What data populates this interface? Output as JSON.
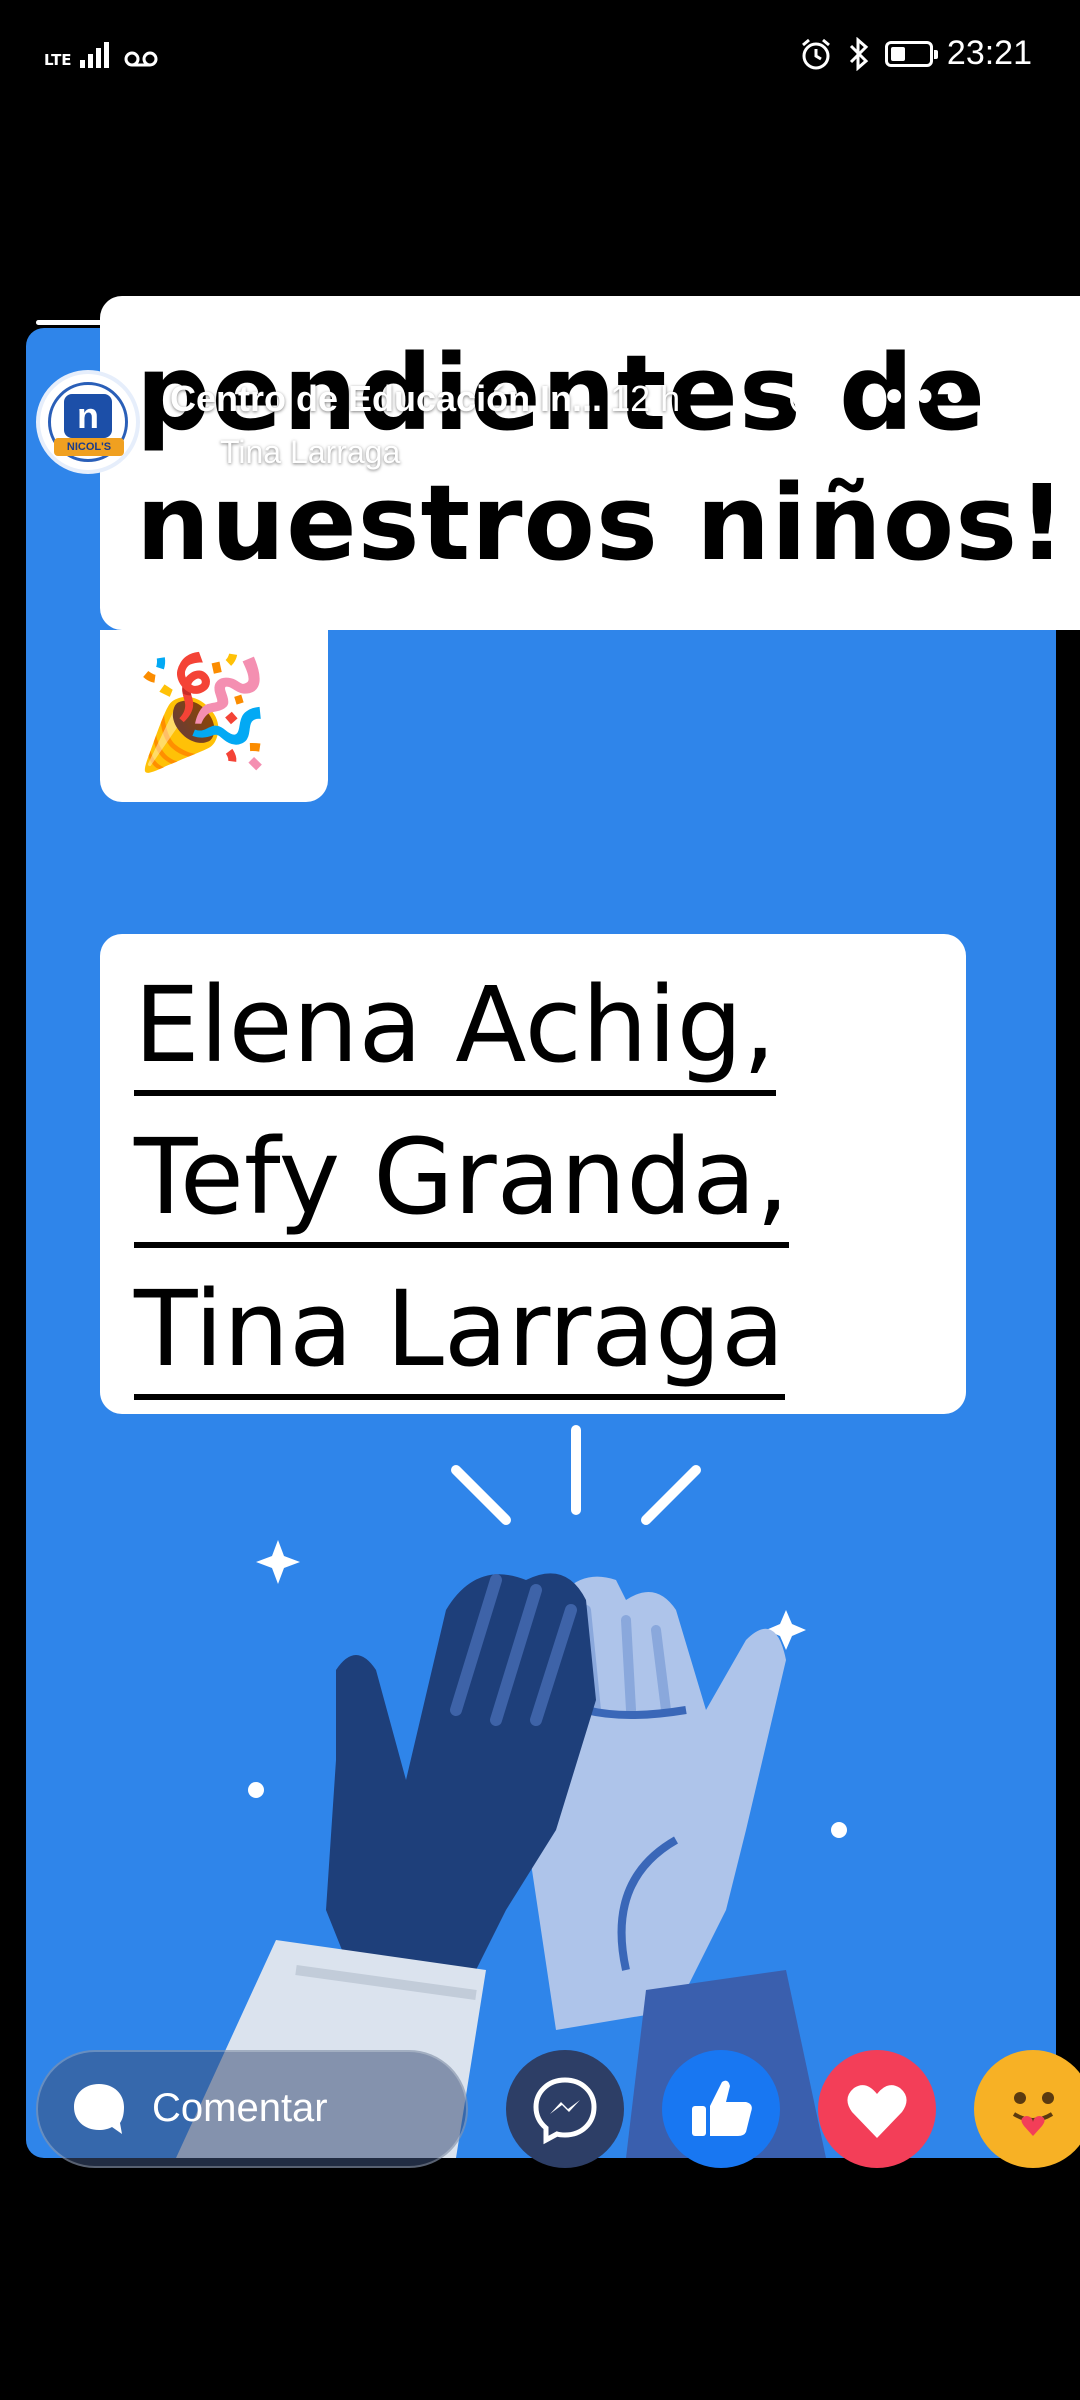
{
  "status_bar": {
    "network": "LTE",
    "time": "23:21"
  },
  "story": {
    "progress": 0.73,
    "page_name": "Centro de Educación In...",
    "time_ago": "12 h",
    "poster_name": "Tina Larraga",
    "avatar_brand": "NICOL'S",
    "text_line_1": "pendientes de",
    "text_line_2": "nuestros niños!",
    "names": [
      "Elena Achig,",
      "Tefy Granda,",
      "Tina Larraga"
    ]
  },
  "bottom_bar": {
    "comment_label": "Comentar",
    "reactions": [
      "messenger-icon",
      "like-icon",
      "love-icon",
      "care-icon"
    ]
  },
  "colors": {
    "story_bg": "#2f85ea",
    "like": "#1877f2",
    "love": "#f33e58",
    "care": "#f7b125"
  }
}
